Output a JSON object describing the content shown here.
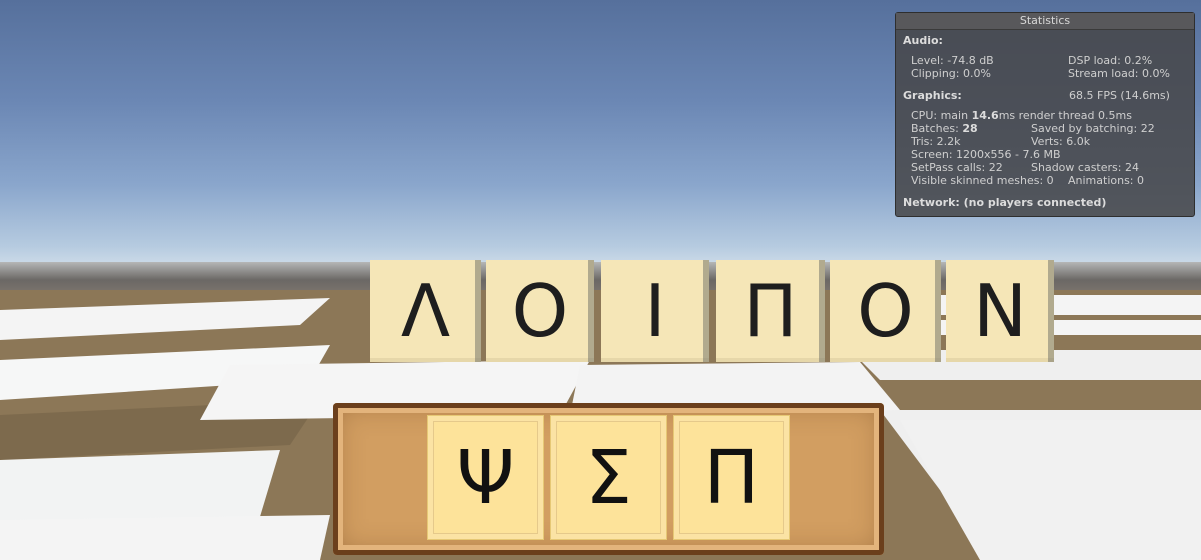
{
  "word_tiles": [
    {
      "letter": "Λ"
    },
    {
      "letter": "Ο"
    },
    {
      "letter": "Ι"
    },
    {
      "letter": "Π"
    },
    {
      "letter": "Ο"
    },
    {
      "letter": "Ν"
    }
  ],
  "rack_tiles": [
    {
      "letter": "Ψ"
    },
    {
      "letter": "Σ"
    },
    {
      "letter": "Π"
    }
  ],
  "statistics": {
    "title": "Statistics",
    "audio_heading": "Audio:",
    "level": "Level: -74.8 dB",
    "dsp_load": "DSP load: 0.2%",
    "clipping": "Clipping: 0.0%",
    "stream_load": "Stream load: 0.0%",
    "graphics_heading": "Graphics:",
    "fps": "68.5 FPS (14.6ms)",
    "cpu_prefix": "CPU: main ",
    "cpu_main": "14.6",
    "cpu_suffix": "ms  render thread 0.5ms",
    "batches_prefix": "Batches: ",
    "batches": "28",
    "saved_by_batching": "Saved by batching: 22",
    "tris": "Tris: 2.2k",
    "verts": "Verts: 6.0k",
    "screen": "Screen: 1200x556 - 7.6 MB",
    "setpass": "SetPass calls: 22",
    "shadow_casters": "Shadow casters: 24",
    "skinned": "Visible skinned meshes: 0",
    "animations": "Animations: 0",
    "network": "Network: (no players connected)"
  }
}
